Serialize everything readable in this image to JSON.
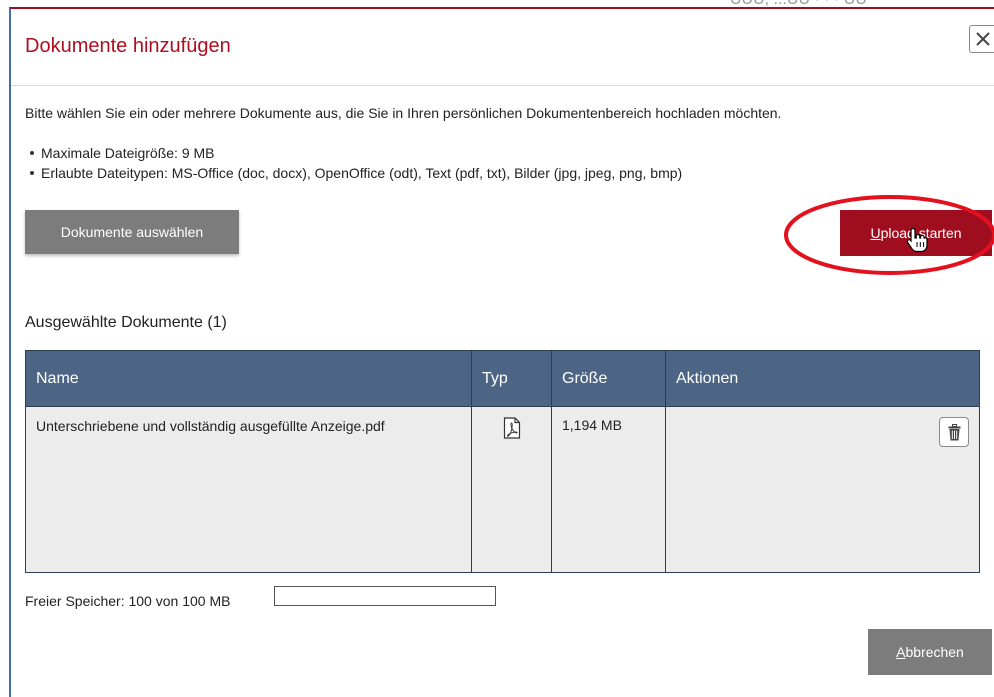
{
  "background": {
    "partial_text": "UUU, ...UU   ·   ·   ·   UU"
  },
  "dialog": {
    "title": "Dokumente hinzufügen",
    "close_symbol": "✕",
    "intro": "Bitte wählen Sie ein oder mehrere Dokumente aus, die Sie in Ihren persönlichen Dokumentenbereich hochladen möchten.",
    "bullets": [
      "Maximale Dateigröße: 9 MB",
      "Erlaubte Dateitypen: MS-Office (doc, docx), OpenOffice (odt), Text (pdf, txt), Bilder (jpg, jpeg, png, bmp)"
    ],
    "select_button": "Dokumente auswählen",
    "upload_button": {
      "mnemonic": "U",
      "rest": "pload starten"
    },
    "section_title": "Ausgewählte Dokumente (1)",
    "table": {
      "headers": [
        "Name",
        "Typ",
        "Größe",
        "Aktionen"
      ],
      "rows": [
        {
          "name": "Unterschriebene und vollständig ausgefüllte Anzeige.pdf",
          "type_icon": "pdf-file-icon",
          "size": "1,194 MB",
          "action_icon": "trash-icon"
        }
      ]
    },
    "storage": {
      "label": "Freier Speicher: 100 von 100 MB",
      "used_fraction": 0
    },
    "cancel_button": {
      "mnemonic": "A",
      "rest": "bbrechen"
    }
  },
  "colors": {
    "title_red": "#b00e1f",
    "primary_button": "#9e0e1f",
    "secondary_button": "#7c7c7c",
    "table_header": "#4c6584",
    "table_row": "#ececec",
    "highlight_ellipse": "#e3101e"
  },
  "annotation": {
    "shape": "ellipse",
    "target": "upload-start-button"
  },
  "cursor": {
    "icon": "hand-pointer-icon"
  }
}
